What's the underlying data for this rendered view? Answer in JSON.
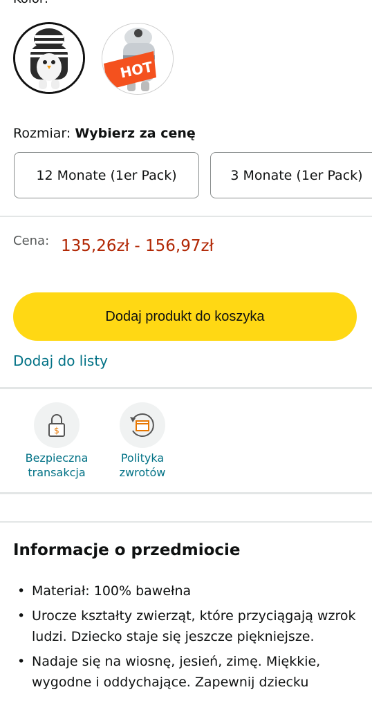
{
  "color_section": {
    "label_cut": "Kolor:"
  },
  "swatches": [
    {
      "name": "penguin-romper",
      "selected": true
    },
    {
      "name": "white-hooded-romper-hot",
      "badge": "HOT",
      "selected": false
    }
  ],
  "size": {
    "label": "Rozmiar:",
    "value": "Wybierz za cenę",
    "options": [
      "12 Monate (1er Pack)",
      "3 Monate (1er Pack)"
    ]
  },
  "price": {
    "label": "Cena:",
    "value": "135,26zł - 156,97zł"
  },
  "actions": {
    "add_to_cart": "Dodaj produkt do koszyka",
    "add_to_list": "Dodaj do listy"
  },
  "features": [
    {
      "icon": "secure-lock-icon",
      "label_line1": "Bezpieczna",
      "label_line2": "transakcja"
    },
    {
      "icon": "return-box-icon",
      "label_line1": "Polityka",
      "label_line2": "zwrotów"
    }
  ],
  "info": {
    "title": "Informacje o przedmiocie",
    "bullets": [
      "Materiał: 100% bawełna",
      "Urocze kształty zwierząt, które przyciągają wzrok ludzi. Dziecko staje się jeszcze piękniejsze.",
      "Nadaje się na wiosnę, jesień, zimę. Miękkie, wygodne i oddychające. Zapewnij dziecku"
    ]
  },
  "colors": {
    "price": "#b12704",
    "link": "#007185",
    "cart_button": "#ffd814"
  }
}
